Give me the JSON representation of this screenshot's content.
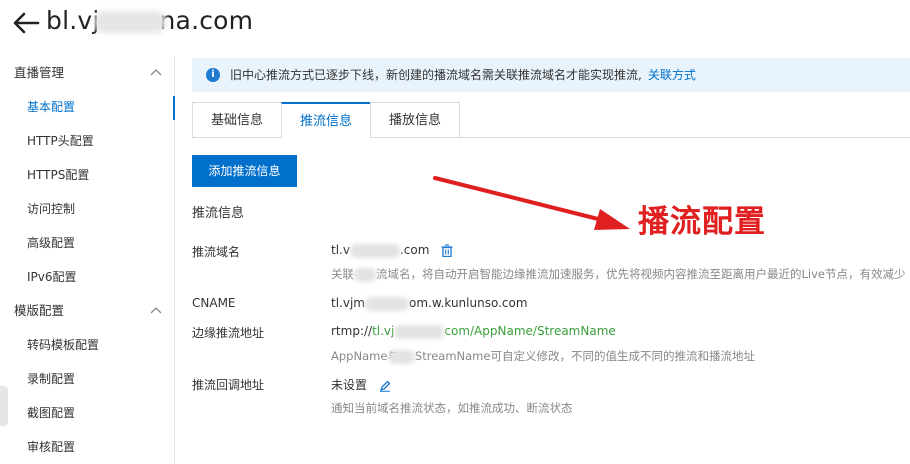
{
  "header": {
    "title_prefix": "bl.vj",
    "title_suffix": "na.com"
  },
  "sidebar": {
    "groups": [
      {
        "label": "直播管理",
        "items": [
          "基本配置",
          "HTTP头配置",
          "HTTPS配置",
          "访问控制",
          "高级配置",
          "IPv6配置"
        ]
      },
      {
        "label": "模版配置",
        "items": [
          "转码模板配置",
          "录制配置",
          "截图配置",
          "审核配置"
        ]
      }
    ],
    "active_item": "基本配置"
  },
  "notice": {
    "text": "旧中心推流方式已逐步下线，新创建的播流域名需关联推流域名才能实现推流,",
    "link": "关联方式"
  },
  "tabs": [
    "基础信息",
    "推流信息",
    "播放信息"
  ],
  "active_tab": "推流信息",
  "add_button": "添加推流信息",
  "section_title": "推流信息",
  "rows": {
    "domain": {
      "label": "推流域名",
      "value_prefix": "tl.v",
      "value_suffix": ".com",
      "desc_prefix": "关联",
      "desc_suffix": "流域名，将自动开启智能边缘推流加速服务，优先将视频内容推流至距离用户最近的Live节点，有效减少"
    },
    "cname": {
      "label": "CNAME",
      "value_prefix": "tl.vjm",
      "value_suffix": "om.w.kunlunso.com"
    },
    "edge": {
      "label": "边缘推流地址",
      "value_prefix": "rtmp://",
      "value_link_prefix": "tl.vj",
      "value_link_mid": "com/",
      "app_name": "AppName",
      "slash": "/",
      "stream_name": "StreamName",
      "desc_prefix": "AppName与",
      "desc_suffix": "StreamName可自定义修改，不同的值生成不同的推流和播流地址"
    },
    "callback": {
      "label": "推流回调地址",
      "value": "未设置",
      "desc": "通知当前域名推流状态，如推流成功、断流状态"
    }
  },
  "annotation": {
    "text": "播流配置",
    "color": "#e02020"
  },
  "colors": {
    "accent": "#0070cc",
    "notice_bg": "#e9f3fc",
    "link_green": "#3a9f3a"
  }
}
